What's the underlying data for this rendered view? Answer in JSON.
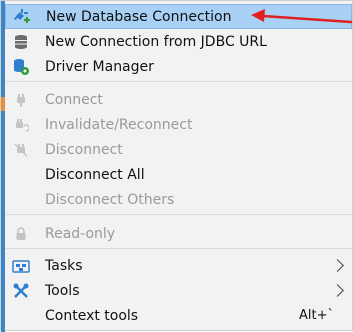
{
  "menu": {
    "items": [
      {
        "label": "New Database Connection",
        "icon": "plug-add-icon",
        "highlighted": true
      },
      {
        "label": "New Connection from JDBC URL",
        "icon": "database-stack-icon"
      },
      {
        "label": "Driver Manager",
        "icon": "driver-manager-icon"
      },
      {
        "label": "Connect",
        "icon": "plug-icon",
        "disabled": true
      },
      {
        "label": "Invalidate/Reconnect",
        "icon": "reconnect-icon",
        "disabled": true
      },
      {
        "label": "Disconnect",
        "icon": "unplug-icon",
        "disabled": true
      },
      {
        "label": "Disconnect All"
      },
      {
        "label": "Disconnect Others",
        "disabled": true
      },
      {
        "label": "Read-only",
        "icon": "lock-icon",
        "disabled": true
      },
      {
        "label": "Tasks",
        "icon": "tasks-icon",
        "submenu": true
      },
      {
        "label": "Tools",
        "icon": "tools-icon",
        "submenu": true
      },
      {
        "label": "Context tools",
        "shortcut": "Alt+`"
      }
    ]
  },
  "colors": {
    "highlight": "#a9d1f5",
    "annotation_arrow": "#e02020",
    "disabled_text": "#9a9a9a"
  }
}
